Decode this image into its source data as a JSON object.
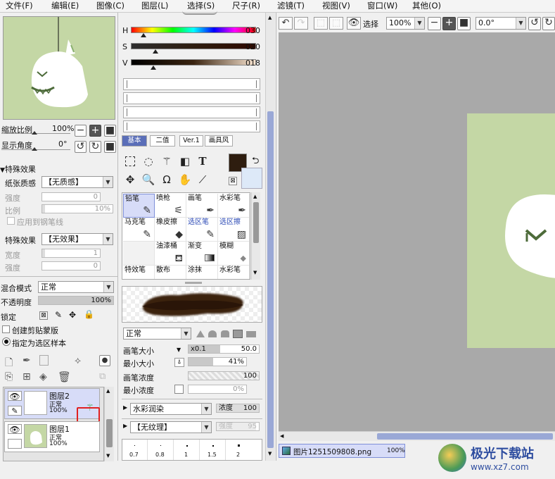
{
  "menu": [
    "文件(F)",
    "编辑(E)",
    "图像(C)",
    "图层(L)",
    "选择(S)",
    "尺子(R)",
    "滤镜(T)",
    "视图(V)",
    "窗口(W)",
    "其他(O)"
  ],
  "navigator": {
    "zoom_label": "缩放比例",
    "zoom_value": "100%",
    "rotate_label": "显示角度",
    "rotate_value": "0°"
  },
  "effects": {
    "header": "特殊效果",
    "paper_label": "纸张质感",
    "paper_value": "【无质感】",
    "strength_label": "强度",
    "strength_value": "0",
    "scale_label": "比例",
    "scale_value": "10%",
    "pen_checkbox": "应用到钢笔线",
    "effect_label": "特殊效果",
    "effect_value": "【无效果】",
    "width_label": "宽度",
    "width_value": "1",
    "strength2_label": "强度",
    "strength2_value": "0"
  },
  "layer_props": {
    "blend_label": "混合模式",
    "blend_value": "正常",
    "opacity_label": "不透明度",
    "opacity_value": "100%",
    "lock_label": "锁定",
    "clip_label": "创建剪贴蒙版",
    "sample_label": "指定为选区样本"
  },
  "layers": [
    {
      "name": "图层2",
      "mode": "正常",
      "opacity": "100%"
    },
    {
      "name": "图层1",
      "mode": "正常",
      "opacity": "100%"
    }
  ],
  "hsv": {
    "h_label": "H",
    "h_value": "030",
    "s_label": "S",
    "s_value": "020",
    "v_label": "V",
    "v_value": "018"
  },
  "tool_tabs": [
    "基本",
    "二值",
    "Ver.1",
    "画具风"
  ],
  "brushes": [
    {
      "name": "铅笔",
      "icon": "pencil-icon",
      "glyph": "✎"
    },
    {
      "name": "喷枪",
      "icon": "airbrush-icon",
      "glyph": "⚟"
    },
    {
      "name": "画笔",
      "icon": "brush-icon",
      "glyph": "✒"
    },
    {
      "name": "水彩笔",
      "icon": "watercolor-icon",
      "glyph": "✒"
    },
    {
      "name": "马克笔",
      "icon": "marker-icon",
      "glyph": "✎"
    },
    {
      "name": "橡皮擦",
      "icon": "eraser-icon",
      "glyph": "◆"
    },
    {
      "name": "选区笔",
      "icon": "selection-pen-icon",
      "glyph": "✎"
    },
    {
      "name": "选区擦",
      "icon": "selection-eraser-icon",
      "glyph": "▨"
    },
    {
      "name": "",
      "icon": "",
      "glyph": ""
    },
    {
      "name": "油漆桶",
      "icon": "bucket-icon",
      "glyph": "⛾"
    },
    {
      "name": "渐变",
      "icon": "gradient-icon",
      "glyph": "▮"
    },
    {
      "name": "模糊",
      "icon": "blur-icon",
      "glyph": "💧"
    },
    {
      "name": "特效笔",
      "icon": "effect-pen-icon",
      "glyph": ""
    },
    {
      "name": "散布",
      "icon": "scatter-icon",
      "glyph": ""
    },
    {
      "name": "涂抹",
      "icon": "smudge-icon",
      "glyph": ""
    },
    {
      "name": "水彩笔",
      "icon": "watercolor2-icon",
      "glyph": ""
    }
  ],
  "brush_settings": {
    "blend_value": "正常",
    "size_label": "画笔大小",
    "size_mult": "x0.1",
    "size_value": "50.0",
    "min_size_label": "最小大小",
    "min_size_value": "41%",
    "density_label": "画笔浓度",
    "density_value": "100",
    "min_density_label": "最小浓度",
    "min_density_value": "0%",
    "texture_value": "水彩润染",
    "texture_density_label": "浓度",
    "texture_density_value": "100",
    "texture2_value": "【无纹理】",
    "texture2_strength_label": "强度",
    "texture2_strength_value": "95",
    "dot_labels": [
      "0.7",
      "0.8",
      "1",
      "1.5",
      "2"
    ]
  },
  "toolbar": {
    "select_label": "选择",
    "zoom_value": "100%",
    "angle_value": "0.0°"
  },
  "statusbar": {
    "filename": "图片1251509808.png",
    "zoom": "100%"
  },
  "colors": {
    "canvas_bg": "#c4d7a5",
    "workspace": "#a9a9a9",
    "fg_color": "#2e1d0f",
    "bg_color": "#dde9f8",
    "highlight_red": "#e02020"
  },
  "watermark": "极光下载站 www.xz7.com"
}
